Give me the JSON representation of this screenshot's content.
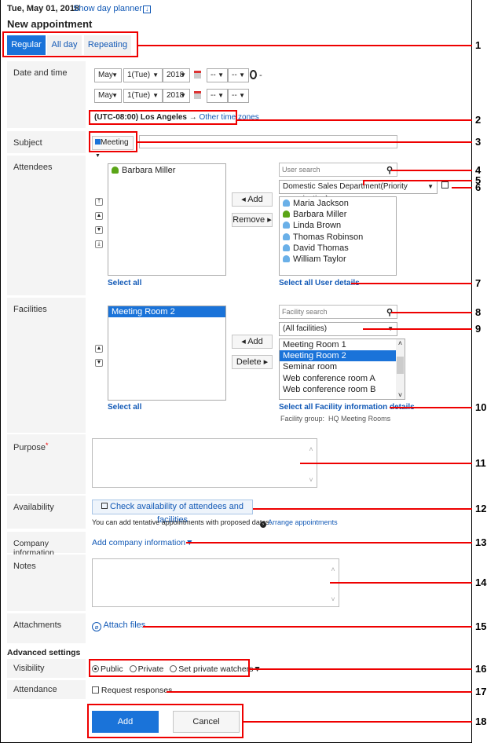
{
  "header": {
    "date": "Tue, May 01, 2018",
    "show_day_planner": "Show day planner",
    "title": "New appointment"
  },
  "tabs": [
    {
      "label": "Regular",
      "active": true
    },
    {
      "label": "All day",
      "active": false
    },
    {
      "label": "Repeating",
      "active": false
    }
  ],
  "date_time": {
    "label": "Date and time",
    "start": {
      "month": "May",
      "day": "1(Tue)",
      "year": "2018",
      "hour": "--",
      "minute": "--"
    },
    "end": {
      "month": "May",
      "day": "1(Tue)",
      "year": "2018",
      "hour": "--",
      "minute": "--"
    },
    "separator": "-",
    "timezone": "(UTC-08:00) Los Angeles",
    "timezone_arrow": "→",
    "other_time_zones": "Other time zones"
  },
  "subject": {
    "label": "Subject",
    "menu": "Meeting",
    "menu_color": "#1a73d9",
    "value": ""
  },
  "attendees": {
    "label": "Attendees",
    "selected": [
      "Barbara Miller"
    ],
    "add_button": "◂ Add",
    "remove_button": "Remove ▸",
    "select_all": "Select all",
    "search_placeholder": "User search",
    "organization": "Domestic Sales Department(Priority organization)",
    "candidates": [
      {
        "name": "Maria Jackson",
        "highlight": false
      },
      {
        "name": "Barbara Miller",
        "highlight": true
      },
      {
        "name": "Linda Brown",
        "highlight": false
      },
      {
        "name": "Thomas Robinson",
        "highlight": false
      },
      {
        "name": "David Thomas",
        "highlight": false
      },
      {
        "name": "William Taylor",
        "highlight": false
      }
    ],
    "candidates_select_all": "Select all",
    "user_details": "User details"
  },
  "facilities": {
    "label": "Facilities",
    "selected": [
      "Meeting Room 2"
    ],
    "add_button": "◂ Add",
    "delete_button": "Delete ▸",
    "select_all": "Select all",
    "search_placeholder": "Facility search",
    "group_filter": "(All facilities)",
    "candidates": [
      "Meeting Room 1",
      "Meeting Room 2",
      "Seminar room",
      "Web conference room A",
      "Web conference room B"
    ],
    "candidates_selected": "Meeting Room 2",
    "candidates_select_all": "Select all",
    "facility_info_details": "Facility information details",
    "facility_group_label": "Facility group:",
    "facility_group_value": "HQ Meeting Rooms"
  },
  "purpose": {
    "label": "Purpose",
    "required_mark": "*",
    "value": ""
  },
  "availability": {
    "label": "Availability",
    "check_button": "Check availability of attendees and facilities",
    "note": "You can add tentative appointments with proposed dates.",
    "arrange_link": "Arrange appointments"
  },
  "company_info": {
    "label": "Company information",
    "link": "Add company information▼"
  },
  "notes": {
    "label": "Notes",
    "value": ""
  },
  "attachments": {
    "label": "Attachments",
    "link": "Attach files"
  },
  "advanced": {
    "heading": "Advanced settings",
    "visibility_label": "Visibility",
    "visibility_options": [
      {
        "label": "Public",
        "checked": true
      },
      {
        "label": "Private",
        "checked": false
      },
      {
        "label": "Set private watchers▼",
        "checked": false
      }
    ],
    "attendance_label": "Attendance",
    "request_responses": "Request responses",
    "request_responses_checked": false
  },
  "actions": {
    "add": "Add",
    "cancel": "Cancel"
  },
  "callouts": [
    "1",
    "2",
    "3",
    "4",
    "5",
    "6",
    "7",
    "8",
    "9",
    "10",
    "11",
    "12",
    "13",
    "14",
    "15",
    "16",
    "17",
    "18"
  ]
}
